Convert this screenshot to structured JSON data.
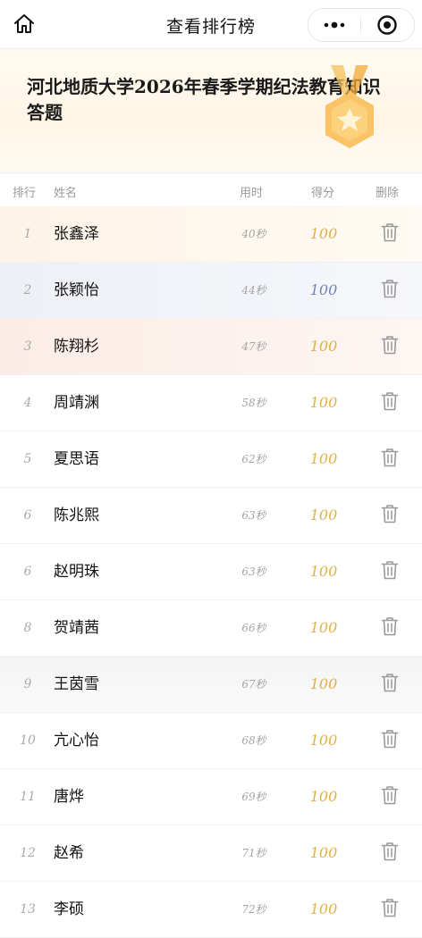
{
  "navbar": {
    "title": "查看排行榜",
    "home_icon": "home-icon",
    "more_icon": "more-dots-icon",
    "close_icon": "target-close-icon"
  },
  "banner": {
    "title": "河北地质大学2026年春季学期纪法教育知识答题",
    "medal_icon": "star-medal-icon",
    "medal_color": "#f7b23b"
  },
  "table": {
    "headers": {
      "rank": "排行",
      "name": "姓名",
      "time": "用时",
      "score": "得分",
      "delete": "删除"
    },
    "rows": [
      {
        "rank": "1",
        "name": "张鑫泽",
        "time": "40秒",
        "score": "100"
      },
      {
        "rank": "2",
        "name": "张颖怡",
        "time": "44秒",
        "score": "100"
      },
      {
        "rank": "3",
        "name": "陈翔杉",
        "time": "47秒",
        "score": "100"
      },
      {
        "rank": "4",
        "name": "周靖渊",
        "time": "58秒",
        "score": "100"
      },
      {
        "rank": "5",
        "name": "夏思语",
        "time": "62秒",
        "score": "100"
      },
      {
        "rank": "6",
        "name": "陈兆熙",
        "time": "63秒",
        "score": "100"
      },
      {
        "rank": "6",
        "name": "赵明珠",
        "time": "63秒",
        "score": "100"
      },
      {
        "rank": "8",
        "name": "贺靖茜",
        "time": "66秒",
        "score": "100"
      },
      {
        "rank": "9",
        "name": "王茵雪",
        "time": "67秒",
        "score": "100"
      },
      {
        "rank": "10",
        "name": "亢心怡",
        "time": "68秒",
        "score": "100"
      },
      {
        "rank": "11",
        "name": "唐烨",
        "time": "69秒",
        "score": "100"
      },
      {
        "rank": "12",
        "name": "赵希",
        "time": "71秒",
        "score": "100"
      },
      {
        "rank": "13",
        "name": "李硕",
        "time": "72秒",
        "score": "100"
      }
    ]
  },
  "colors": {
    "gold_score": "#e0b04a",
    "silver_score": "#6f83b5",
    "trash_icon": "#999999"
  }
}
